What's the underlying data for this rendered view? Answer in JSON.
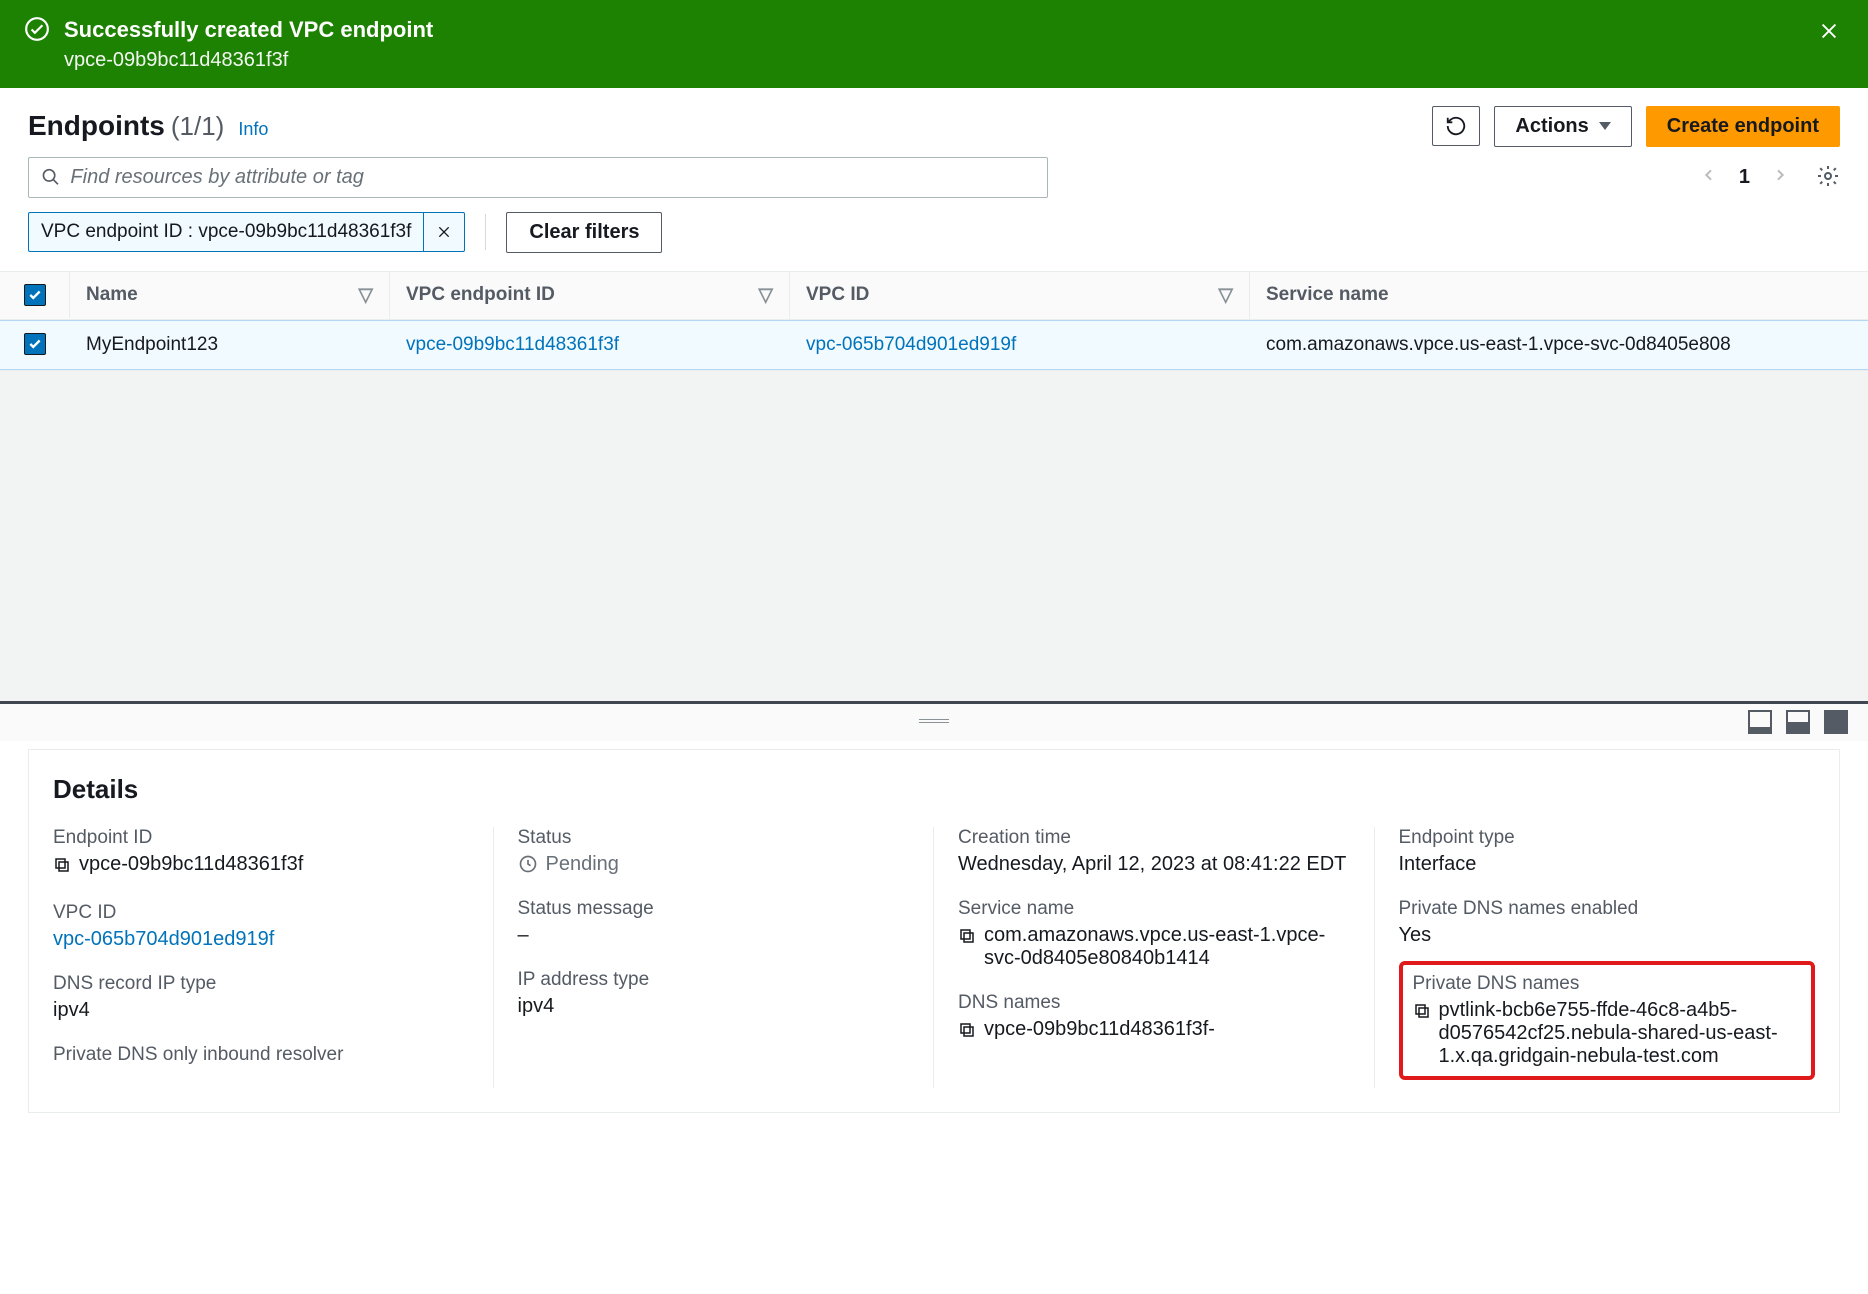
{
  "banner": {
    "title": "Successfully created VPC endpoint",
    "subtitle": "vpce-09b9bc11d48361f3f"
  },
  "header": {
    "title": "Endpoints",
    "count": "(1/1)",
    "info": "Info",
    "actions_label": "Actions",
    "create_label": "Create endpoint"
  },
  "search": {
    "placeholder": "Find resources by attribute or tag",
    "page": "1"
  },
  "filters": {
    "tag_text": "VPC endpoint ID : vpce-09b9bc11d48361f3f",
    "clear_label": "Clear filters"
  },
  "table": {
    "headers": {
      "name": "Name",
      "endpoint_id": "VPC endpoint ID",
      "vpc_id": "VPC ID",
      "service_name": "Service name"
    },
    "rows": [
      {
        "name": "MyEndpoint123",
        "endpoint_id": "vpce-09b9bc11d48361f3f",
        "vpc_id": "vpc-065b704d901ed919f",
        "service_name": "com.amazonaws.vpce.us-east-1.vpce-svc-0d8405e808"
      }
    ]
  },
  "details": {
    "title": "Details",
    "endpoint_id_label": "Endpoint ID",
    "endpoint_id": "vpce-09b9bc11d48361f3f",
    "vpc_id_label": "VPC ID",
    "vpc_id": "vpc-065b704d901ed919f",
    "dns_record_ip_type_label": "DNS record IP type",
    "dns_record_ip_type": "ipv4",
    "private_dns_inbound_label": "Private DNS only inbound resolver",
    "status_label": "Status",
    "status": "Pending",
    "status_message_label": "Status message",
    "status_message": "–",
    "ip_address_type_label": "IP address type",
    "ip_address_type": "ipv4",
    "creation_time_label": "Creation time",
    "creation_time": "Wednesday, April 12, 2023 at 08:41:22 EDT",
    "service_name_label": "Service name",
    "service_name": "com.amazonaws.vpce.us-east-1.vpce-svc-0d8405e80840b1414",
    "dns_names_label": "DNS names",
    "dns_names": "vpce-09b9bc11d48361f3f-",
    "endpoint_type_label": "Endpoint type",
    "endpoint_type": "Interface",
    "private_dns_enabled_label": "Private DNS names enabled",
    "private_dns_enabled": "Yes",
    "private_dns_names_label": "Private DNS names",
    "private_dns_names": "pvtlink-bcb6e755-ffde-46c8-a4b5-d0576542cf25.nebula-shared-us-east-1.x.qa.gridgain-nebula-test.com"
  }
}
